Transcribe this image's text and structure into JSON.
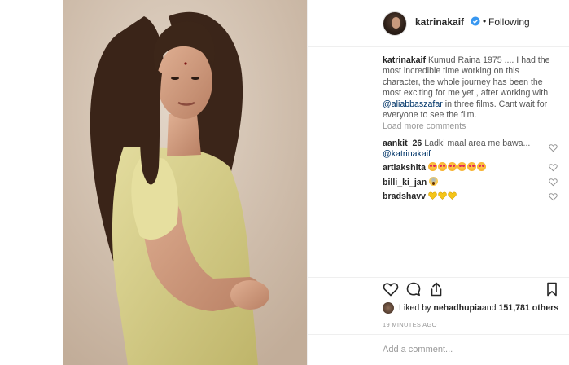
{
  "post": {
    "username": "katrinakaif",
    "follow_separator": "•",
    "follow_state": "Following"
  },
  "caption": {
    "username": "katrinakaif",
    "text_before": " Kumud Raina 1975 .... I had the most incredible time working on this character, the whole journey has been the most exciting for me yet , after working with ",
    "mention": "@aliabbaszafar",
    "text_after": " in three films. Cant wait for everyone to see the film."
  },
  "load_more": "Load more comments",
  "comments": [
    {
      "username": "aankit_26",
      "text": " Ladki maal area me bawa... ",
      "mention": "@katrinakaif"
    },
    {
      "username": "artiakshita",
      "emoji": [
        "love-eyes-emoji",
        "love-eyes-emoji",
        "love-eyes-emoji",
        "love-eyes-emoji",
        "love-eyes-emoji",
        "love-eyes-emoji"
      ]
    },
    {
      "username": "billi_ki_jan",
      "emoji": [
        "scream-emoji"
      ]
    },
    {
      "username": "bradshavv",
      "emoji": [
        "yellow-heart-emoji",
        "yellow-heart-emoji",
        "yellow-heart-emoji"
      ]
    }
  ],
  "likes": {
    "prefix": "Liked by ",
    "user": "nehadhupia",
    "middle": " and ",
    "count": "151,781 others"
  },
  "timestamp": "19 MINUTES AGO",
  "comment_input": {
    "placeholder": "Add a comment..."
  },
  "colors": {
    "verified": "#3897f0",
    "mention": "#003569",
    "muted": "#999999",
    "dress": "#d8d08a"
  }
}
